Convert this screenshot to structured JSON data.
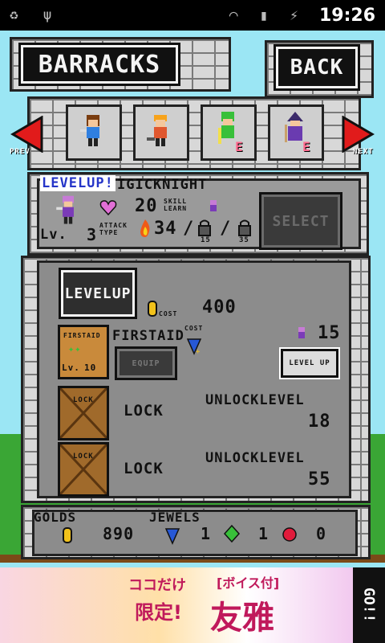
{
  "status_bar": {
    "time": "19:26"
  },
  "header": {
    "title": "BARRACKS",
    "back_label": "BACK"
  },
  "nav": {
    "prev_label": "PREV",
    "next_label": "NEXT"
  },
  "hero_slots": [
    {
      "name": "knight",
      "badge": "",
      "color": "#2f7fe0"
    },
    {
      "name": "warrior",
      "badge": "",
      "color": "#e0572f"
    },
    {
      "name": "healer",
      "badge": "E",
      "color": "#38c03a"
    },
    {
      "name": "mage",
      "badge": "E",
      "color": "#6a3bb0"
    }
  ],
  "selected_unit": {
    "levelup_banner": "LEVELUP!",
    "name": "IGICKNIGHT",
    "hp": "20",
    "attack_type_label": "ATTACK TYPE",
    "attack": "34",
    "skill_learn_label": "SKILL LEARN",
    "skill_1_level": "15",
    "skill_2_level": "35",
    "level_label": "Lv.",
    "level_value": "3",
    "select_label": "SELECT"
  },
  "levelup": {
    "button_label": "LEVELUP",
    "cost_label": "COST",
    "cost_value": "400"
  },
  "skills": [
    {
      "name": "FIRSTAID",
      "card_label": "FIRSTAID",
      "level_label": "Lv.",
      "level_value": "10",
      "equip_label": "EQUIP",
      "cost_label": "COST",
      "unit_count": "15",
      "level_up_label": "LEVEL UP"
    }
  ],
  "locked_slots": [
    {
      "card_label": "LOCK",
      "lock_text": "LOCK",
      "unlock_label": "UNLOCKLEVEL",
      "unlock_level": "18"
    },
    {
      "card_label": "LOCK",
      "lock_text": "LOCK",
      "unlock_label": "UNLOCKLEVEL",
      "unlock_level": "55"
    }
  ],
  "currency": {
    "golds_label": "GOLDS",
    "golds_value": "890",
    "jewels_label": "JEWELS",
    "jewel_blue": "1",
    "jewel_green": "1",
    "jewel_red": "0"
  },
  "ad": {
    "line1": "ココだけ",
    "line2": "限定!",
    "tag": "[ボイス付]",
    "title": "友雅",
    "go": "GO!!"
  },
  "colors": {
    "sky": "#9be6f4",
    "grass": "#3aa635",
    "arrow": "#e11b1b",
    "gold": "#f2c21b"
  }
}
